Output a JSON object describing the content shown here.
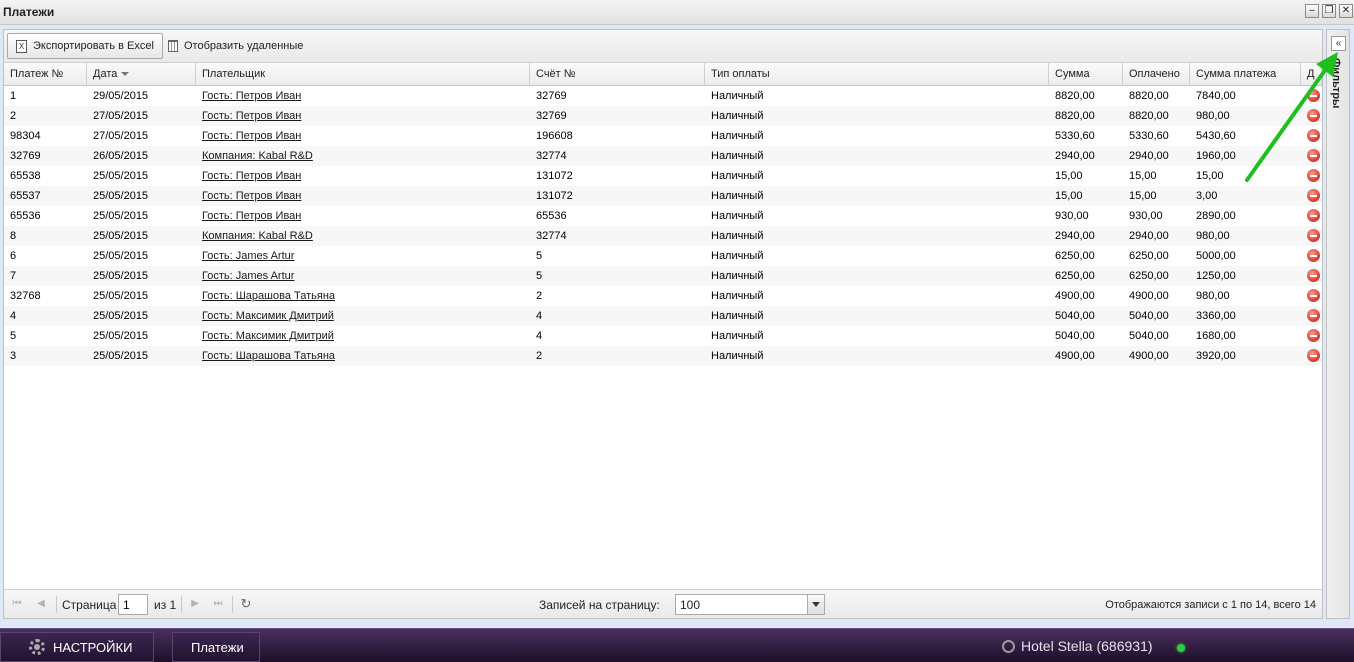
{
  "window": {
    "title": "Платежи",
    "minimize": "–",
    "restore": "❐",
    "close": "✕"
  },
  "toolbar": {
    "export_label": "Экспортировать в Excel",
    "export_icon": "X",
    "show_deleted_label": "Отобразить удаленные"
  },
  "grid": {
    "columns": [
      "Платеж №",
      "Дата",
      "Плательщик",
      "Счёт №",
      "Тип оплаты",
      "Сумма",
      "Оплачено",
      "Сумма платежа",
      "Д"
    ],
    "sorted_column": "Дата",
    "rows": [
      [
        "1",
        "29/05/2015",
        "Гость: Петров Иван",
        "32769",
        "Наличный",
        "8820,00",
        "8820,00",
        "7840,00"
      ],
      [
        "2",
        "27/05/2015",
        "Гость: Петров Иван",
        "32769",
        "Наличный",
        "8820,00",
        "8820,00",
        "980,00"
      ],
      [
        "98304",
        "27/05/2015",
        "Гость: Петров Иван",
        "196608",
        "Наличный",
        "5330,60",
        "5330,60",
        "5430,60"
      ],
      [
        "32769",
        "26/05/2015",
        "Компания: Kabal R&D",
        "32774",
        "Наличный",
        "2940,00",
        "2940,00",
        "1960,00"
      ],
      [
        "65538",
        "25/05/2015",
        "Гость: Петров Иван",
        "131072",
        "Наличный",
        "15,00",
        "15,00",
        "15,00"
      ],
      [
        "65537",
        "25/05/2015",
        "Гость: Петров Иван",
        "131072",
        "Наличный",
        "15,00",
        "15,00",
        "3,00"
      ],
      [
        "65536",
        "25/05/2015",
        "Гость: Петров Иван",
        "65536",
        "Наличный",
        "930,00",
        "930,00",
        "2890,00"
      ],
      [
        "8",
        "25/05/2015",
        "Компания: Kabal R&D",
        "32774",
        "Наличный",
        "2940,00",
        "2940,00",
        "980,00"
      ],
      [
        "6",
        "25/05/2015",
        "Гость: James Artur",
        "5",
        "Наличный",
        "6250,00",
        "6250,00",
        "5000,00"
      ],
      [
        "7",
        "25/05/2015",
        "Гость: James Artur",
        "5",
        "Наличный",
        "6250,00",
        "6250,00",
        "1250,00"
      ],
      [
        "32768",
        "25/05/2015",
        "Гость: Шарашова Татьяна",
        "2",
        "Наличный",
        "4900,00",
        "4900,00",
        "980,00"
      ],
      [
        "4",
        "25/05/2015",
        "Гость: Максимик Дмитрий",
        "4",
        "Наличный",
        "5040,00",
        "5040,00",
        "3360,00"
      ],
      [
        "5",
        "25/05/2015",
        "Гость: Максимик Дмитрий",
        "4",
        "Наличный",
        "5040,00",
        "5040,00",
        "1680,00"
      ],
      [
        "3",
        "25/05/2015",
        "Гость: Шарашова Татьяна",
        "2",
        "Наличный",
        "4900,00",
        "4900,00",
        "3920,00"
      ]
    ]
  },
  "pager": {
    "page_label": "Страница",
    "page_value": "1",
    "of_label": "из 1",
    "per_page_label": "Записей на страницу:",
    "per_page_value": "100",
    "summary": "Отображаются записи с 1 по 14, всего 14"
  },
  "filters": {
    "label": "Фильтры",
    "collapse_glyph": "«"
  },
  "taskbar": {
    "settings_label": "НАСТРОЙКИ",
    "payments_label": "Платежи",
    "hotel_label": "Hotel Stella (686931)",
    "status_color": "#2ecc40"
  },
  "annotation": {
    "arrow_color": "#1fbf1f"
  }
}
